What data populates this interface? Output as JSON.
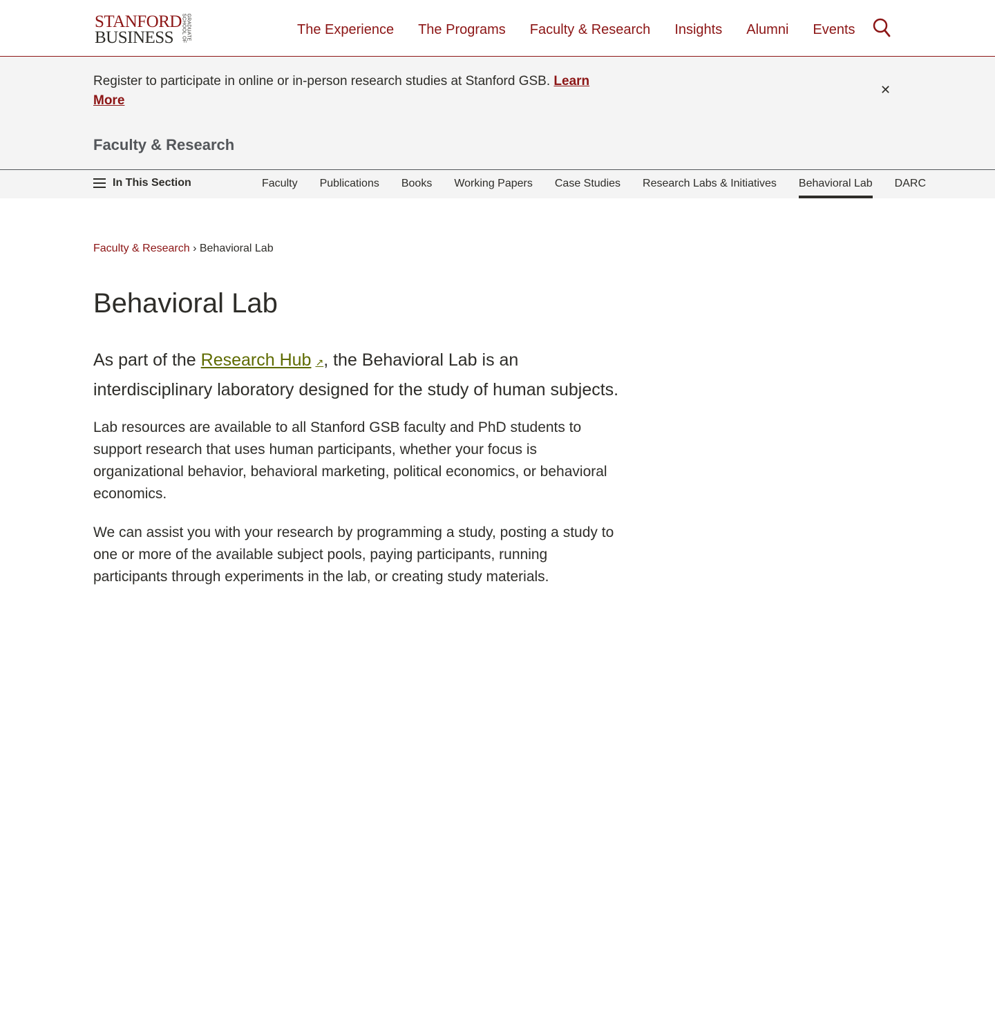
{
  "header": {
    "logo": {
      "line1": "STANFORD",
      "line2": "BUSINESS",
      "vertical_line1": "GRADUATE",
      "vertical_line2": "SCHOOL OF"
    },
    "nav": [
      {
        "label": "The Experience"
      },
      {
        "label": "The Programs"
      },
      {
        "label": "Faculty & Research"
      },
      {
        "label": "Insights"
      },
      {
        "label": "Alumni"
      },
      {
        "label": "Events"
      }
    ],
    "search_icon": "search-icon"
  },
  "notice": {
    "text": "Register to participate in online or in-person research studies at Stanford GSB.",
    "link_label": "Learn More",
    "close_label": "✕"
  },
  "section": {
    "title": "Faculty & Research",
    "in_this_section": "In This Section",
    "subnav": [
      {
        "label": "Faculty"
      },
      {
        "label": "Publications"
      },
      {
        "label": "Books"
      },
      {
        "label": "Working Papers"
      },
      {
        "label": "Case Studies"
      },
      {
        "label": "Research Labs & Initiatives"
      },
      {
        "label": "Behavioral Lab"
      },
      {
        "label": "DARC"
      }
    ],
    "active_item": "Behavioral Lab"
  },
  "breadcrumb": {
    "parent": "Faculty & Research",
    "separator": "›",
    "current": "Behavioral Lab"
  },
  "content": {
    "title": "Behavioral Lab",
    "lead_prefix": "As part of the",
    "lead_link": "Research Hub",
    "lead_suffix": ", the Behavioral Lab is an interdisciplinary laboratory designed for the study of human subjects.",
    "paragraph1": "Lab resources are available to all Stanford GSB faculty and PhD students to support research that uses human participants, whether your focus is organizational behavior, behavioral marketing, political economics, or behavioral economics.",
    "paragraph2": "We can assist you with your research by programming a study, posting a study to one or more of the available subject pools, paying participants, running participants through experiments in the lab, or creating study materials."
  },
  "colors": {
    "cardinal": "#8c1515",
    "text": "#2e2d29",
    "link_green": "#5e6b00",
    "banner_bg": "#f4f4f4"
  }
}
